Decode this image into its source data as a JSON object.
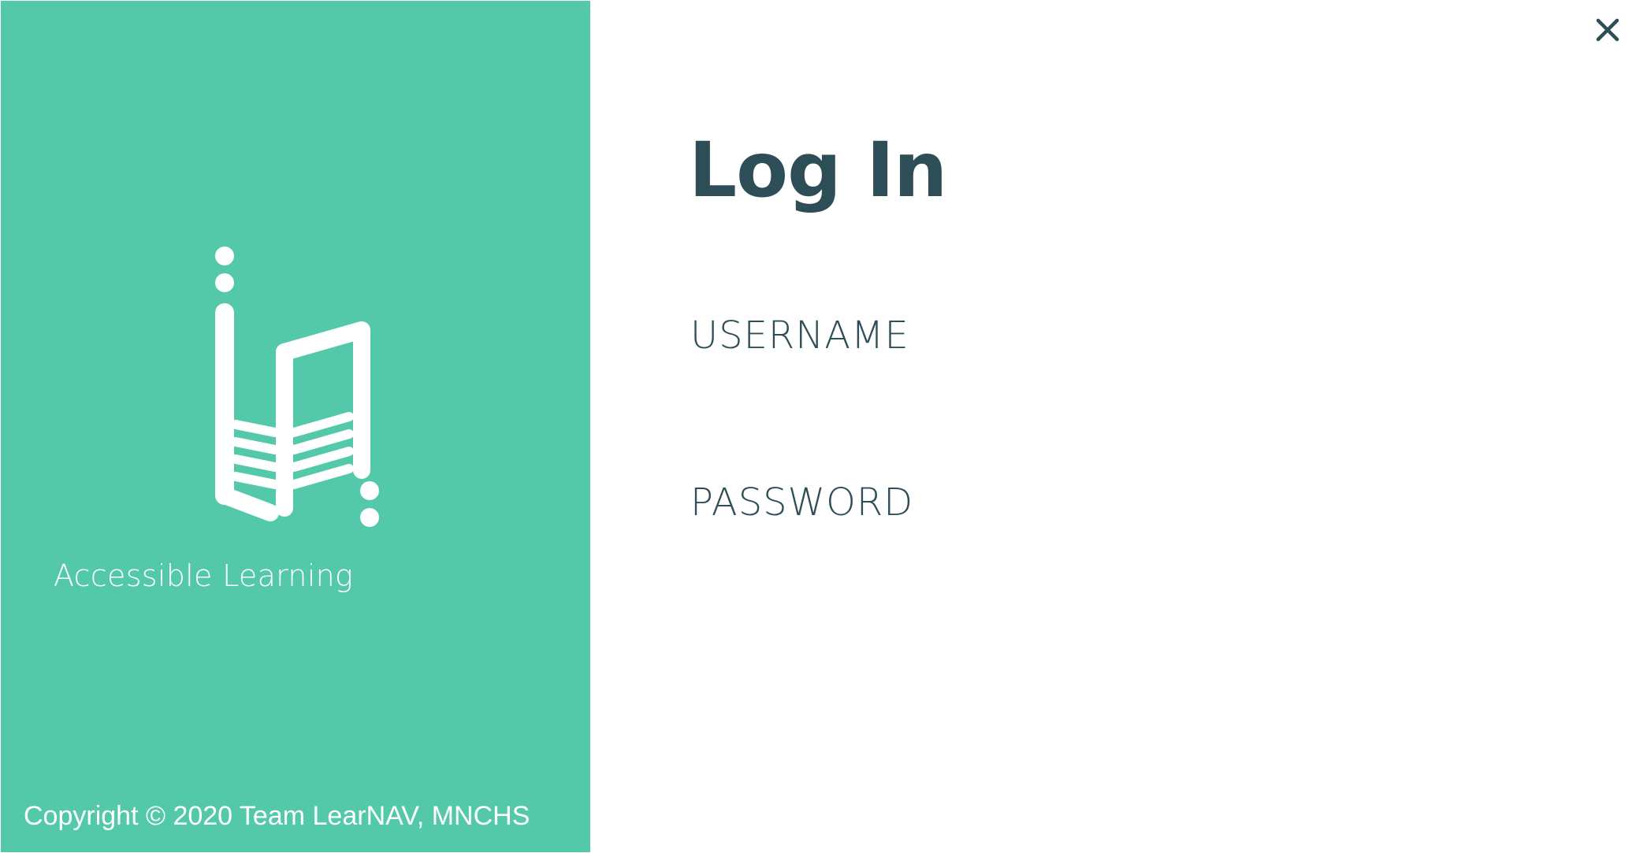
{
  "branding": {
    "tagline": "Accessible Learning",
    "copyright": "Copyright © 2020 Team LearNAV, MNCHS",
    "logo_icon": "learnav-logo-icon",
    "accent_color": "#54c9aa"
  },
  "login": {
    "title": "Log In",
    "username_label": "USERNAME",
    "username_value": "",
    "password_label": "PASSWORD",
    "password_value": "",
    "text_color": "#2e4e57"
  },
  "window": {
    "close_icon": "close-icon"
  }
}
